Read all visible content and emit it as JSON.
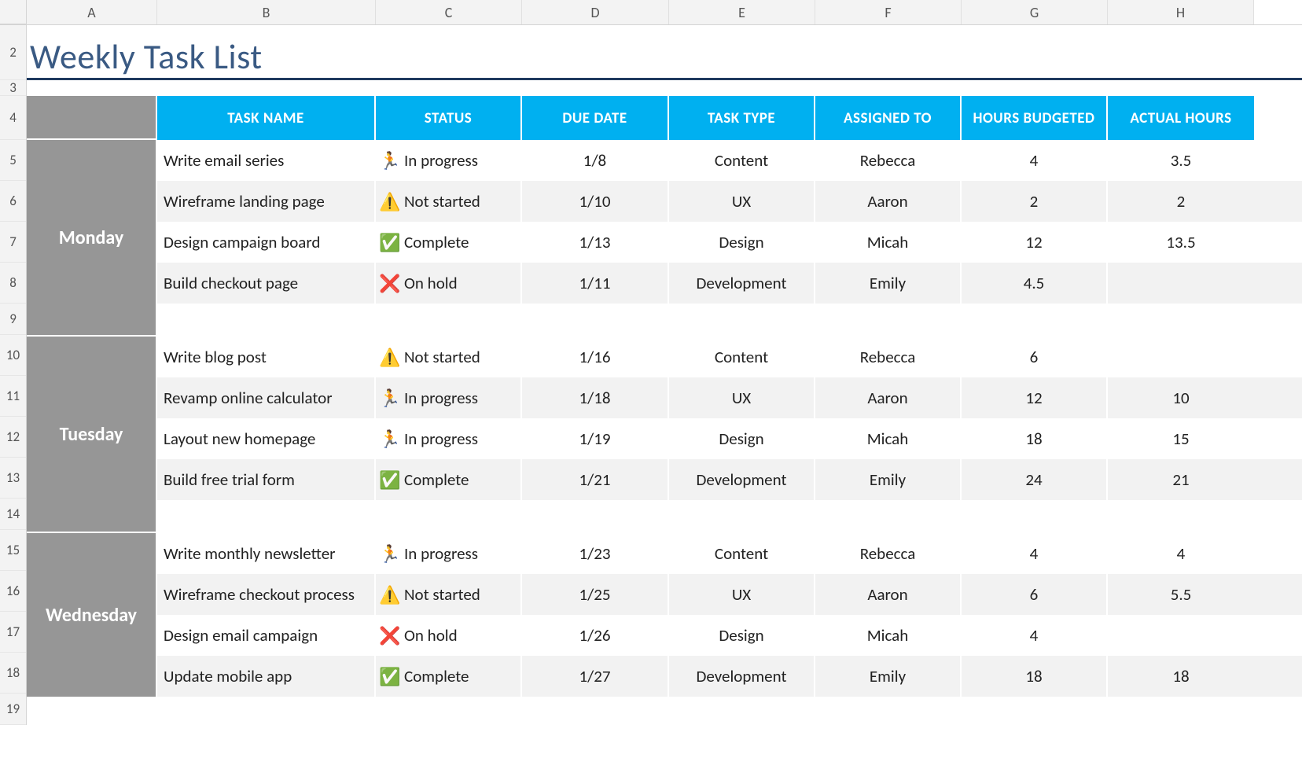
{
  "columns": [
    "A",
    "B",
    "C",
    "D",
    "E",
    "F",
    "G",
    "H"
  ],
  "rowNumbers": [
    "",
    "2",
    "3",
    "4",
    "5",
    "6",
    "7",
    "8",
    "9",
    "10",
    "11",
    "12",
    "13",
    "14",
    "15",
    "16",
    "17",
    "18",
    "19"
  ],
  "title": "Weekly Task List",
  "headers": {
    "taskName": "TASK NAME",
    "status": "STATUS",
    "dueDate": "DUE DATE",
    "taskType": "TASK TYPE",
    "assignedTo": "ASSIGNED TO",
    "hoursBudgeted": "HOURS BUDGETED",
    "actualHours": "ACTUAL HOURS"
  },
  "statusIcons": {
    "In progress": "🏃",
    "Not started": "⚠️",
    "Complete": "✅",
    "On hold": "❌"
  },
  "days": [
    {
      "name": "Monday",
      "tasks": [
        {
          "taskName": "Write email series",
          "status": "In progress",
          "dueDate": "1/8",
          "taskType": "Content",
          "assignedTo": "Rebecca",
          "hoursBudgeted": "4",
          "actualHours": "3.5"
        },
        {
          "taskName": "Wireframe landing page",
          "status": "Not started",
          "dueDate": "1/10",
          "taskType": "UX",
          "assignedTo": "Aaron",
          "hoursBudgeted": "2",
          "actualHours": "2"
        },
        {
          "taskName": "Design campaign board",
          "status": "Complete",
          "dueDate": "1/13",
          "taskType": "Design",
          "assignedTo": "Micah",
          "hoursBudgeted": "12",
          "actualHours": "13.5"
        },
        {
          "taskName": "Build checkout page",
          "status": "On hold",
          "dueDate": "1/11",
          "taskType": "Development",
          "assignedTo": "Emily",
          "hoursBudgeted": "4.5",
          "actualHours": ""
        }
      ],
      "emptyRow": true
    },
    {
      "name": "Tuesday",
      "tasks": [
        {
          "taskName": "Write blog post",
          "status": "Not started",
          "dueDate": "1/16",
          "taskType": "Content",
          "assignedTo": "Rebecca",
          "hoursBudgeted": "6",
          "actualHours": ""
        },
        {
          "taskName": "Revamp online calculator",
          "status": "In progress",
          "dueDate": "1/18",
          "taskType": "UX",
          "assignedTo": "Aaron",
          "hoursBudgeted": "12",
          "actualHours": "10"
        },
        {
          "taskName": "Layout new homepage",
          "status": "In progress",
          "dueDate": "1/19",
          "taskType": "Design",
          "assignedTo": "Micah",
          "hoursBudgeted": "18",
          "actualHours": "15"
        },
        {
          "taskName": "Build free trial form",
          "status": "Complete",
          "dueDate": "1/21",
          "taskType": "Development",
          "assignedTo": "Emily",
          "hoursBudgeted": "24",
          "actualHours": "21"
        }
      ],
      "emptyRow": true
    },
    {
      "name": "Wednesday",
      "tasks": [
        {
          "taskName": "Write monthly newsletter",
          "status": "In progress",
          "dueDate": "1/23",
          "taskType": "Content",
          "assignedTo": "Rebecca",
          "hoursBudgeted": "4",
          "actualHours": "4"
        },
        {
          "taskName": "Wireframe checkout process",
          "status": "Not started",
          "dueDate": "1/25",
          "taskType": "UX",
          "assignedTo": "Aaron",
          "hoursBudgeted": "6",
          "actualHours": "5.5"
        },
        {
          "taskName": "Design email campaign",
          "status": "On hold",
          "dueDate": "1/26",
          "taskType": "Design",
          "assignedTo": "Micah",
          "hoursBudgeted": "4",
          "actualHours": ""
        },
        {
          "taskName": "Update mobile app",
          "status": "Complete",
          "dueDate": "1/27",
          "taskType": "Development",
          "assignedTo": "Emily",
          "hoursBudgeted": "18",
          "actualHours": "18"
        }
      ],
      "emptyRow": false
    }
  ],
  "rowHeights": {
    "title": 70,
    "spacer": 20,
    "header": 56,
    "task": 52,
    "empty": 40
  }
}
